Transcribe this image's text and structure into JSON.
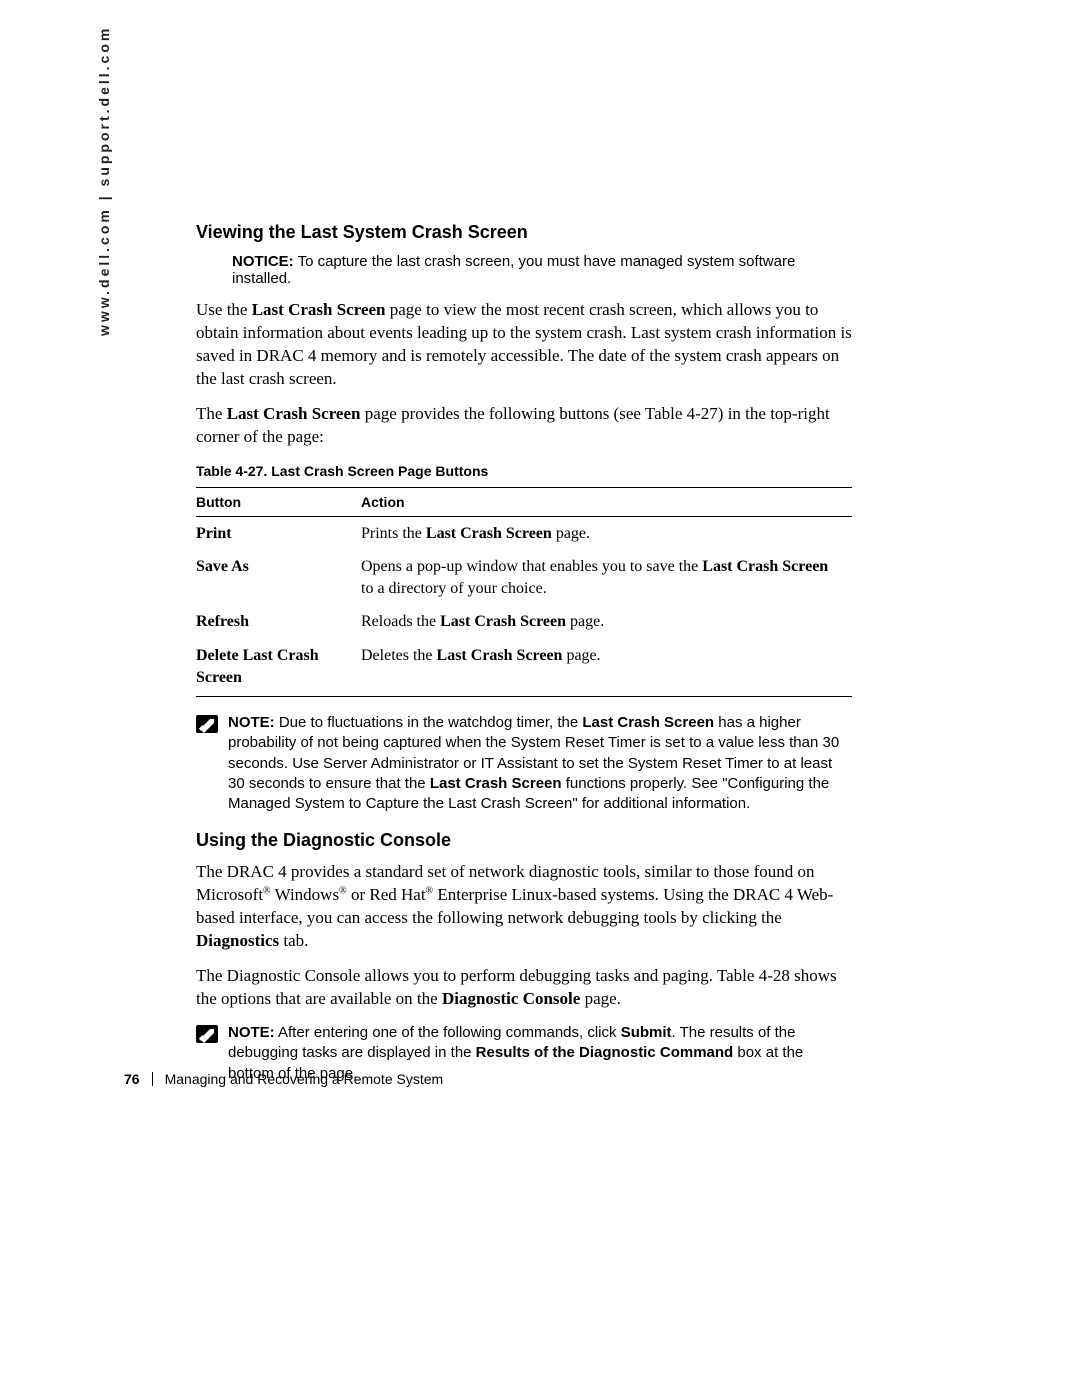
{
  "side_url": "www.dell.com | support.dell.com",
  "section1": {
    "heading": "Viewing the Last System Crash Screen",
    "notice_label": "NOTICE:",
    "notice_text": " To capture the last crash screen, you must have managed system software installed.",
    "para1_pre": "Use the ",
    "para1_bold": "Last Crash Screen",
    "para1_post": " page to view the most recent crash screen, which allows you to obtain information about events leading up to the system crash. Last system crash information is saved in DRAC 4 memory and is remotely accessible. The date of the system crash appears on the last crash screen.",
    "para2_pre": "The ",
    "para2_bold": "Last Crash Screen",
    "para2_post": " page provides the following buttons (see Table 4-27) in the top-right corner of the page:"
  },
  "table": {
    "caption": "Table 4-27.    Last Crash Screen Page Buttons",
    "head_button": "Button",
    "head_action": "Action",
    "rows": [
      {
        "button": "Print",
        "action_pre": "Prints the ",
        "action_bold": "Last Crash Screen",
        "action_post": " page."
      },
      {
        "button": "Save As",
        "action_pre": "Opens a pop-up window that enables you to save the ",
        "action_bold": "Last Crash Screen",
        "action_post": " to a directory of your choice."
      },
      {
        "button": "Refresh",
        "action_pre": "Reloads the ",
        "action_bold": "Last Crash Screen",
        "action_post": " page."
      },
      {
        "button": "Delete Last Crash Screen",
        "action_pre": "Deletes the ",
        "action_bold": "Last Crash Screen",
        "action_post": " page."
      }
    ]
  },
  "note1": {
    "label": "NOTE:",
    "t1": " Due to fluctuations in the watchdog timer, the ",
    "b1": "Last Crash Screen",
    "t2": " has a higher probability of not being captured when the System Reset Timer is set to a value less than 30 seconds. Use Server Administrator or IT Assistant to set the System Reset Timer to at least 30 seconds to ensure that the ",
    "b2": "Last Crash Screen",
    "t3": " functions properly. See \"Configuring the Managed System to Capture the Last Crash Screen\" for additional information."
  },
  "section2": {
    "heading": "Using the Diagnostic Console",
    "para1_t1": "The DRAC 4 provides a standard set of network diagnostic tools, similar to those found on Microsoft",
    "para1_t2": " Windows",
    "para1_t3": " or Red Hat",
    "para1_t4": " Enterprise Linux-based systems. Using the DRAC 4 Web-based interface, you can access the following network debugging tools by clicking the ",
    "para1_bold": "Diagnostics",
    "para1_t5": " tab.",
    "para2_t1": "The Diagnostic Console allows you to perform debugging tasks and paging. Table 4-28 shows the options that are available on the ",
    "para2_bold": "Diagnostic Console",
    "para2_t2": " page."
  },
  "note2": {
    "label": "NOTE:",
    "t1": " After entering one of the following commands, click ",
    "b1": "Submit",
    "t2": ". The results of the debugging tasks are displayed in the ",
    "b2": "Results of the Diagnostic Command",
    "t3": " box at the bottom of the page."
  },
  "footer": {
    "page_number": "76",
    "chapter": "Managing and Recovering a Remote System"
  }
}
